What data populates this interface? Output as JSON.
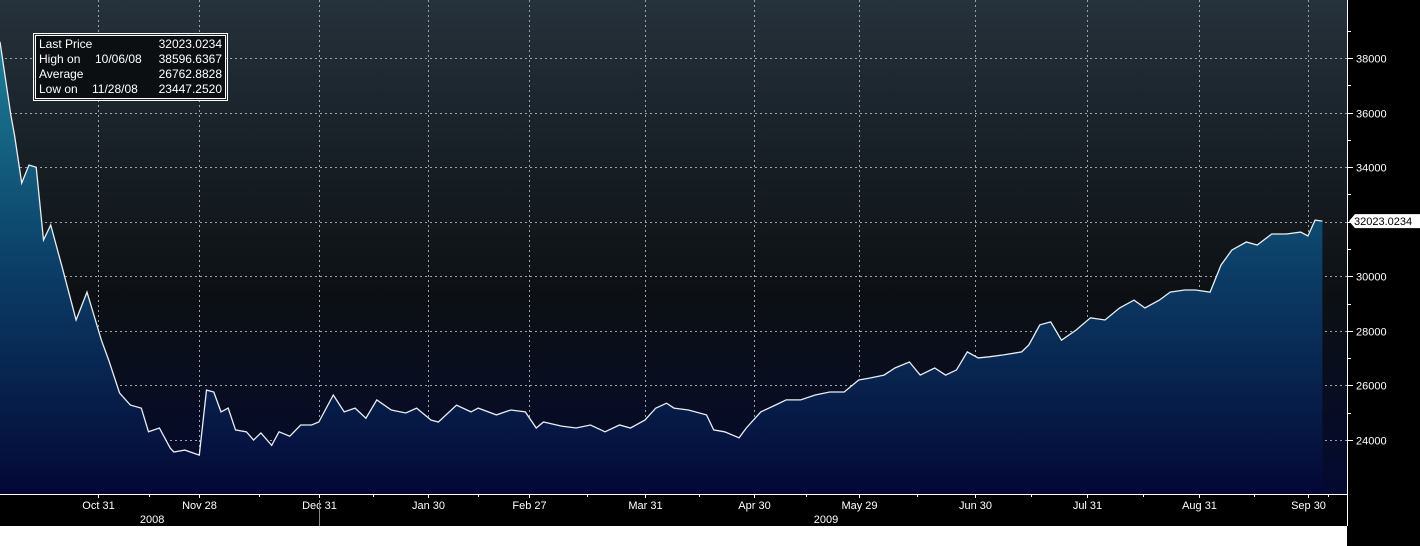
{
  "legend": [
    {
      "label": "Last Price",
      "date": "",
      "value": "32023.0234"
    },
    {
      "label": "High on",
      "date": "10/06/08",
      "value": "38596.6367"
    },
    {
      "label": "Average",
      "date": "",
      "value": "26762.8828"
    },
    {
      "label": "Low on",
      "date": "11/28/08",
      "value": "23447.2520"
    }
  ],
  "last_price_tag": "32023.0234",
  "colors": {
    "line": "#e8eef2",
    "area_top": "#1a7a92",
    "area_bottom": "#040735",
    "bg_top": "#25313b",
    "bg_mid": "#0c1013",
    "bg_bottom": "#040a30"
  },
  "chart_data": {
    "type": "area",
    "title": "",
    "x_origin_date": "2008-10-04",
    "x_unit": "days since origin",
    "xlim": [
      0,
      372
    ],
    "ylim": [
      22020,
      40130
    ],
    "yticks": [
      24000,
      26000,
      28000,
      30000,
      32000,
      34000,
      36000,
      38000
    ],
    "ytick_labels": [
      "24000",
      "26000",
      "28000",
      "30000",
      "32000",
      "34000",
      "36000",
      "38000"
    ],
    "xticks": [
      {
        "day": 27,
        "label": "Oct 31"
      },
      {
        "day": 55,
        "label": "Nov 28"
      },
      {
        "day": 88,
        "label": "Dec 31"
      },
      {
        "day": 118,
        "label": "Jan 30"
      },
      {
        "day": 146,
        "label": "Feb 27"
      },
      {
        "day": 178,
        "label": "Mar 31"
      },
      {
        "day": 208,
        "label": "Apr 30"
      },
      {
        "day": 237,
        "label": "May 29"
      },
      {
        "day": 269,
        "label": "Jun 30"
      },
      {
        "day": 300,
        "label": "Jul 31"
      },
      {
        "day": 331,
        "label": "Aug 31"
      },
      {
        "day": 361,
        "label": "Sep 30"
      }
    ],
    "years": [
      {
        "day": 42,
        "label": "2008"
      },
      {
        "day": 228,
        "label": "2009"
      }
    ],
    "year_divider_day": 88,
    "grid": true,
    "x": [
      0,
      3,
      4,
      6,
      8,
      10,
      12,
      14,
      17,
      21,
      24,
      28,
      30,
      33,
      36,
      39,
      41,
      44,
      47,
      48,
      51,
      55,
      57,
      59,
      61,
      63,
      65,
      68,
      70,
      72,
      75,
      77,
      80,
      83,
      86,
      88,
      92,
      95,
      98,
      101,
      104,
      108,
      112,
      115,
      119,
      121,
      126,
      130,
      132,
      137,
      141,
      145,
      148,
      150,
      155,
      159,
      163,
      167,
      171,
      174,
      178,
      181,
      184,
      186,
      190,
      195,
      197,
      200,
      204,
      206,
      210,
      214,
      217,
      221,
      225,
      229,
      233,
      237,
      240,
      244,
      247,
      251,
      254,
      258,
      261,
      264,
      267,
      270,
      273,
      277,
      282,
      284,
      287,
      290,
      293,
      297,
      301,
      305,
      309,
      313,
      316,
      320,
      323,
      327,
      330,
      334,
      337,
      340,
      344,
      347,
      351,
      355,
      359,
      361,
      363,
      365
    ],
    "y": [
      38596,
      35900,
      35180,
      33420,
      34080,
      34000,
      31330,
      31880,
      30410,
      28400,
      29420,
      27660,
      26930,
      25720,
      25280,
      25170,
      24300,
      24440,
      23700,
      23560,
      23630,
      23447,
      25830,
      25760,
      25030,
      25170,
      24370,
      24300,
      24000,
      24260,
      23800,
      24300,
      24140,
      24550,
      24550,
      24660,
      25650,
      25030,
      25170,
      24800,
      25470,
      25100,
      24990,
      25170,
      24730,
      24660,
      25280,
      25030,
      25170,
      24920,
      25100,
      25030,
      24440,
      24660,
      24510,
      24440,
      24550,
      24300,
      24550,
      24440,
      24730,
      25170,
      25350,
      25170,
      25100,
      24920,
      24370,
      24300,
      24080,
      24440,
      25030,
      25280,
      25470,
      25470,
      25650,
      25760,
      25760,
      26200,
      26270,
      26380,
      26640,
      26860,
      26380,
      26640,
      26380,
      26570,
      27230,
      27010,
      27050,
      27120,
      27230,
      27490,
      28220,
      28330,
      27660,
      28030,
      28480,
      28400,
      28840,
      29130,
      28840,
      29130,
      29420,
      29500,
      29500,
      29420,
      30410,
      30960,
      31260,
      31150,
      31550,
      31550,
      31620,
      31480,
      32060,
      32023
    ]
  }
}
